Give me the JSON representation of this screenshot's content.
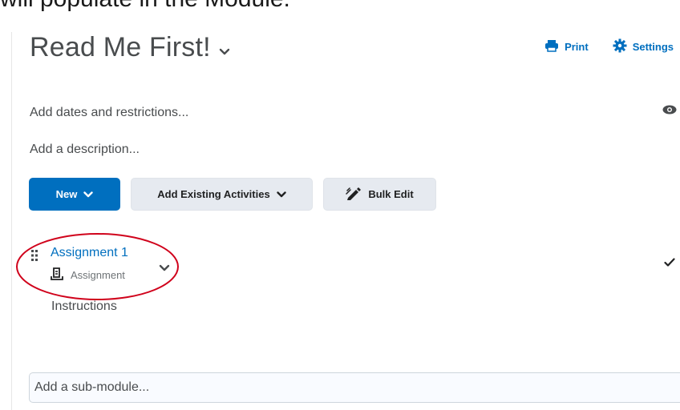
{
  "caption_partial": "will populate in the Module.",
  "module": {
    "title": "Read Me First!",
    "print_label": "Print",
    "settings_label": "Settings",
    "dates_label": "Add dates and restrictions...",
    "description_label": "Add a description..."
  },
  "toolbar": {
    "new_label": "New",
    "add_existing_label": "Add Existing Activities",
    "bulk_edit_label": "Bulk Edit"
  },
  "activities": [
    {
      "title": "Assignment 1",
      "type": "Assignment",
      "description": "Instructions",
      "completed": true
    }
  ],
  "submodule_placeholder": "Add a sub-module...",
  "colors": {
    "accent": "#006fbf",
    "annotation": "#d0021b",
    "text": "#494c4e"
  }
}
